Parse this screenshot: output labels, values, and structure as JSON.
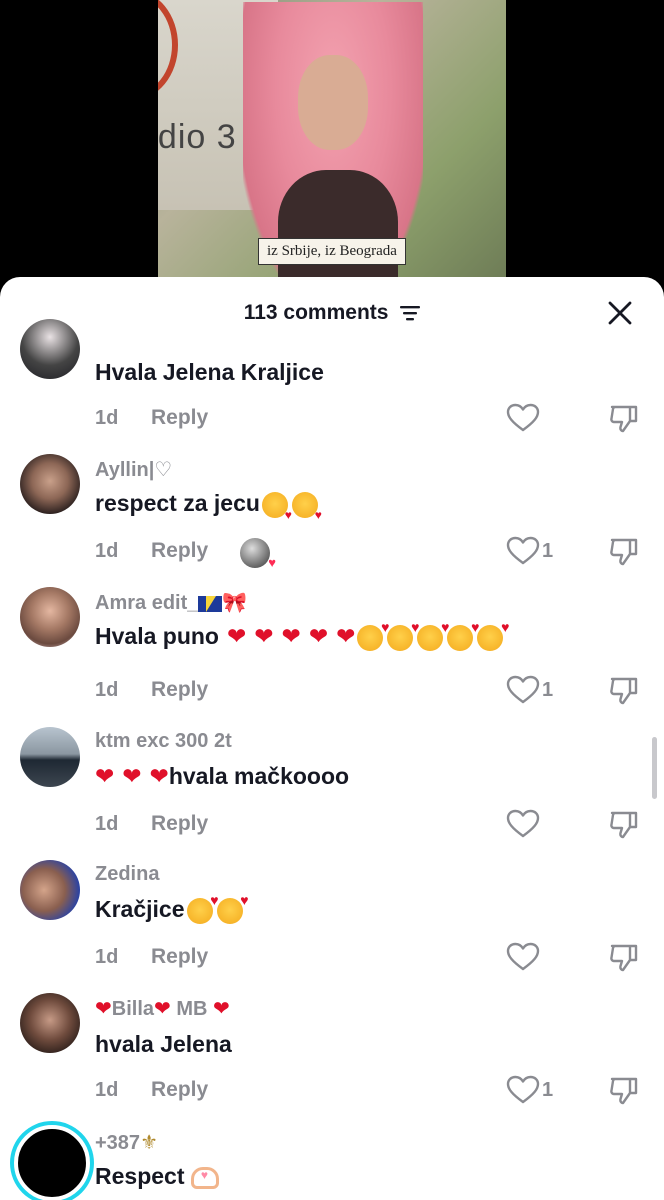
{
  "video": {
    "sign_text": "udio 3",
    "caption": "iz Srbije, iz Beograda"
  },
  "header": {
    "comment_count": "113 comments"
  },
  "comments": [
    {
      "username": "",
      "text": "Hvala Jelena Kraljice",
      "time": "1d",
      "reply": "Reply",
      "likes": ""
    },
    {
      "username": "Ayllin|♡",
      "text": "respect za jecu",
      "time": "1d",
      "reply": "Reply",
      "likes": "1"
    },
    {
      "username": "Amra edit_",
      "text": "Hvala puno",
      "time": "1d",
      "reply": "Reply",
      "likes": "1"
    },
    {
      "username": "ktm exc 300 2t",
      "text": "hvala mačkoooo",
      "time": "1d",
      "reply": "Reply",
      "likes": ""
    },
    {
      "username": "Zedina",
      "text": "Kračjice",
      "time": "1d",
      "reply": "Reply",
      "likes": ""
    },
    {
      "username_a": "Billa",
      "username_b": " MB ",
      "text": "hvala Jelena",
      "time": "1d",
      "reply": "Reply",
      "likes": "1"
    },
    {
      "username": "+387",
      "text": "Respect"
    }
  ],
  "icons": {
    "sort": "sort-lines-icon",
    "close": "close-icon",
    "like": "heart-outline-icon",
    "dislike": "thumbs-down-icon"
  },
  "colors": {
    "text_primary": "#161823",
    "text_secondary": "#8a8b91",
    "heart": "#e0102a",
    "live_ring": "#20d5ec"
  }
}
